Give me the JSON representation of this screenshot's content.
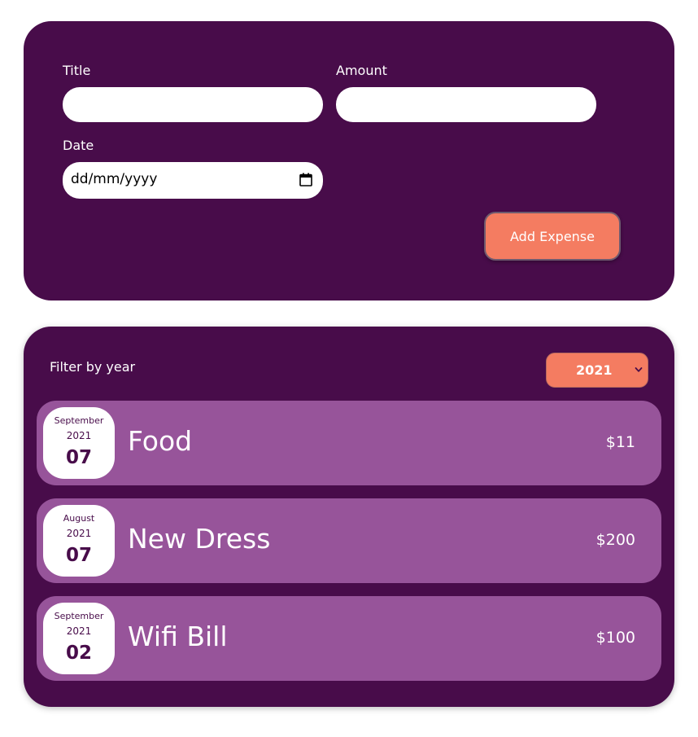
{
  "form": {
    "title_label": "Title",
    "title_value": "",
    "amount_label": "Amount",
    "amount_value": "",
    "date_label": "Date",
    "date_placeholder": "dd/mm/yyyy",
    "submit_label": "Add Expense"
  },
  "filter": {
    "label": "Filter by year",
    "selected_year": "2021"
  },
  "expenses": [
    {
      "month": "September",
      "year": "2021",
      "day": "07",
      "title": "Food",
      "amount": "$11"
    },
    {
      "month": "August",
      "year": "2021",
      "day": "07",
      "title": "New Dress",
      "amount": "$200"
    },
    {
      "month": "September",
      "year": "2021",
      "day": "02",
      "title": "Wifi Bill",
      "amount": "$100"
    }
  ],
  "colors": {
    "panel": "#480c4a",
    "item": "#97549a",
    "accent": "#f47c61"
  }
}
